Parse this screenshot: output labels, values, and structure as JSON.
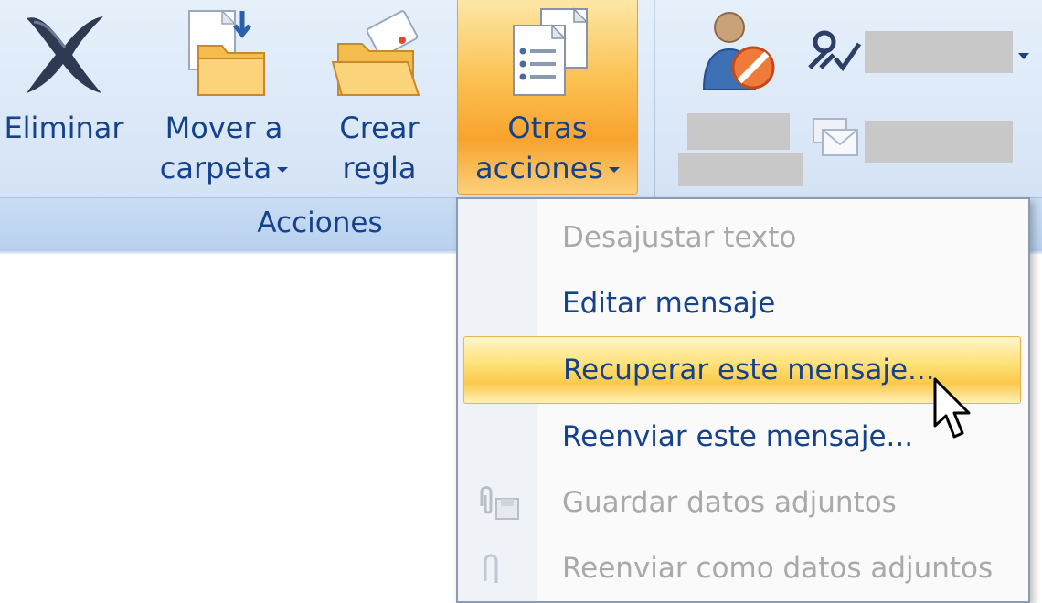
{
  "ribbon": {
    "buttons": {
      "eliminar": {
        "line1": "Eliminar"
      },
      "mover": {
        "line1": "Mover a",
        "line2": "carpeta"
      },
      "crear": {
        "line1": "Crear",
        "line2": "regla"
      },
      "otras": {
        "line1": "Otras",
        "line2": "acciones"
      }
    },
    "group_label": "Acciones",
    "icons": {
      "eliminar": "delete-x-icon",
      "mover": "move-to-folder-icon",
      "crear": "create-rule-folder-icon",
      "otras": "other-actions-documents-icon",
      "block": "block-sender-icon",
      "handshake": "handshake-check-icon",
      "envelopes": "envelopes-icon"
    },
    "colors": {
      "label_text": "#15428b",
      "active_button": "#f8a32d"
    }
  },
  "menu": {
    "items": [
      {
        "label": "Desajustar texto",
        "enabled": false
      },
      {
        "label": "Editar mensaje",
        "enabled": true
      },
      {
        "label": "Recuperar este mensaje...",
        "enabled": true,
        "highlighted": true
      },
      {
        "label": "Reenviar este mensaje...",
        "enabled": true
      },
      {
        "label": "Guardar datos adjuntos",
        "enabled": false,
        "icon": "save-attachments-icon"
      },
      {
        "label": "Reenviar como datos adjuntos",
        "enabled": false,
        "icon": "forward-attachment-icon"
      }
    ],
    "colors": {
      "enabled_text": "#15428b",
      "disabled_text": "#a9a9a9",
      "highlight": "#fbc94b"
    }
  }
}
